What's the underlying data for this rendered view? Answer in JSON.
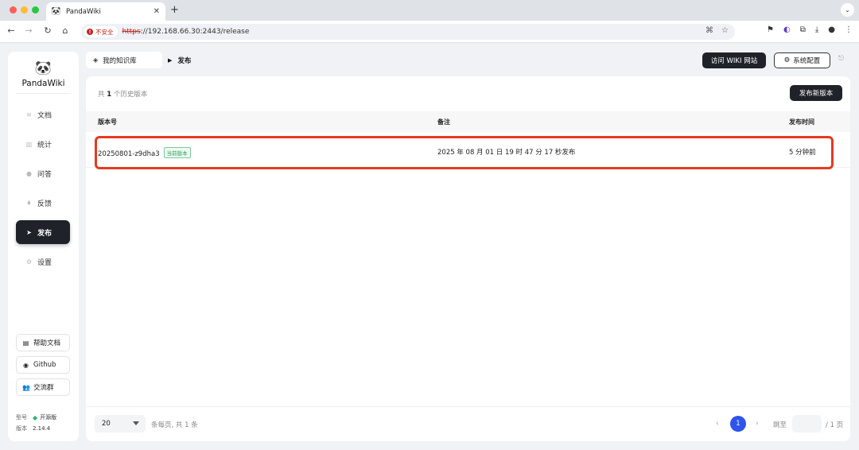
{
  "browser": {
    "tab_title": "PandaWiki",
    "insecure_label": "不安全",
    "url_scheme": "https",
    "url_rest": "://192.168.66.30:2443/release"
  },
  "sidebar": {
    "brand": "PandaWiki",
    "items": [
      {
        "label": "文档",
        "icon": "layers-icon"
      },
      {
        "label": "统计",
        "icon": "bar-chart-icon"
      },
      {
        "label": "问答",
        "icon": "chat-bubble-icon"
      },
      {
        "label": "反馈",
        "icon": "feedback-icon"
      },
      {
        "label": "发布",
        "icon": "send-icon"
      },
      {
        "label": "设置",
        "icon": "gear-icon"
      }
    ],
    "help_doc": "帮助文档",
    "github": "Github",
    "community": "交流群",
    "edition_key": "型号",
    "edition_value": "开源版",
    "version_key": "版本",
    "version_value": "2.14.4"
  },
  "header": {
    "kb_label": "我的知识库",
    "current_page": "发布",
    "visit_button": "访问 WIKI 网站",
    "settings_button": "系统配置"
  },
  "release": {
    "total_prefix": "共",
    "total_count": "1",
    "total_suffix": "个历史版本",
    "publish_button": "发布新版本",
    "columns": {
      "version": "版本号",
      "remark": "备注",
      "time": "发布时间"
    },
    "rows": [
      {
        "version": "20250801-z9dha3",
        "badge": "当前版本",
        "remark": "2025 年 08 月 01 日 19 时 47 分 17 秒发布",
        "time": "5 分钟前"
      }
    ]
  },
  "pagination": {
    "page_size": "20",
    "per_page_text": "条每页, 共 1 条",
    "current_page": "1",
    "jump_label": "跳至",
    "total_pages": "/ 1 页"
  },
  "colors": {
    "active_menu": "#1f2329",
    "highlight_border": "#e53a20",
    "page_current": "#2f54eb",
    "badge_green": "#2aa05b"
  }
}
